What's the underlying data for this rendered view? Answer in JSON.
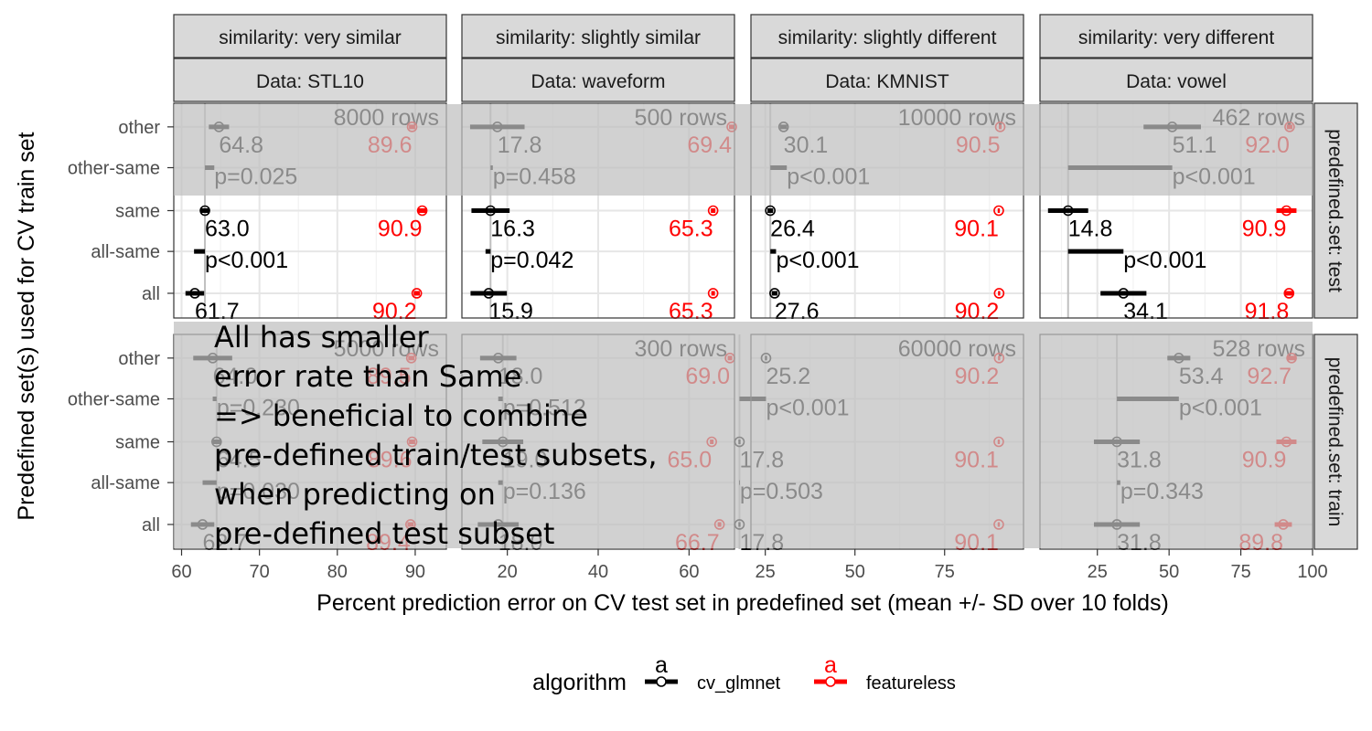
{
  "chart_data": {
    "type": "scatter",
    "columns": [
      {
        "similarity": "similarity: very similar",
        "data": "Data: STL10",
        "xlim": [
          59,
          94
        ],
        "ticks": [
          60,
          70,
          80,
          90
        ]
      },
      {
        "similarity": "similarity: slightly similar",
        "data": "Data: waveform",
        "xlim": [
          10,
          70
        ],
        "ticks": [
          20,
          40,
          60
        ]
      },
      {
        "similarity": "similarity: slightly different",
        "data": "Data: KMNIST",
        "xlim": [
          21,
          97
        ],
        "ticks": [
          25,
          50,
          75
        ]
      },
      {
        "similarity": "similarity: very different",
        "data": "Data: vowel",
        "xlim": [
          5,
          100
        ],
        "ticks": [
          25,
          50,
          75,
          100
        ]
      }
    ],
    "rows": [
      {
        "label": "predefined.set: test"
      },
      {
        "label": "predefined.set: train"
      }
    ],
    "categories": [
      "other",
      "other-same",
      "same",
      "all-same",
      "all"
    ],
    "xlabel": "Percent prediction error on CV test set in predefined set (mean +/- SD over 10 folds)",
    "ylabel": "Predefined set(s) used for CV train set",
    "legend": {
      "title": "algorithm",
      "placement": "bottom",
      "items": [
        {
          "name": "cv_glmnet",
          "color": "#000000",
          "key": "a"
        },
        {
          "name": "featureless",
          "color": "#ff0000",
          "key": "a"
        }
      ]
    },
    "panels": [
      {
        "col": 0,
        "row": 0,
        "rows_text": "8000 rows",
        "points": [
          {
            "cat": "other",
            "algo": "cv_glmnet",
            "mean": 64.8,
            "sd": 1.3,
            "label": "64.8"
          },
          {
            "cat": "other",
            "algo": "featureless",
            "mean": 89.6,
            "sd": 0.4,
            "label": "89.6"
          },
          {
            "cat": "same",
            "algo": "cv_glmnet",
            "mean": 63.0,
            "sd": 0.6,
            "label": "63.0"
          },
          {
            "cat": "same",
            "algo": "featureless",
            "mean": 90.9,
            "sd": 0.6,
            "label": "90.9"
          },
          {
            "cat": "all",
            "algo": "cv_glmnet",
            "mean": 61.7,
            "sd": 1.2,
            "label": "61.7"
          },
          {
            "cat": "all",
            "algo": "featureless",
            "mean": 90.2,
            "sd": 0.4,
            "label": "90.2"
          }
        ],
        "diffs": [
          {
            "cat": "other-same",
            "from": 63.0,
            "to": 64.2,
            "label": "p=0.025"
          },
          {
            "cat": "all-same",
            "from": 61.6,
            "to": 63.0,
            "label": "p<0.001"
          }
        ]
      },
      {
        "col": 1,
        "row": 0,
        "rows_text": "500 rows",
        "points": [
          {
            "cat": "other",
            "algo": "cv_glmnet",
            "mean": 17.8,
            "sd": 6.0,
            "label": "17.8"
          },
          {
            "cat": "other",
            "algo": "featureless",
            "mean": 69.4,
            "sd": 0.6,
            "label": "69.4"
          },
          {
            "cat": "same",
            "algo": "cv_glmnet",
            "mean": 16.3,
            "sd": 4.2,
            "label": "16.3"
          },
          {
            "cat": "same",
            "algo": "featureless",
            "mean": 65.3,
            "sd": 0.5,
            "label": "65.3"
          },
          {
            "cat": "all",
            "algo": "cv_glmnet",
            "mean": 15.9,
            "sd": 4.0,
            "label": "15.9"
          },
          {
            "cat": "all",
            "algo": "featureless",
            "mean": 65.3,
            "sd": 0.4,
            "label": "65.3"
          }
        ],
        "diffs": [
          {
            "cat": "other-same",
            "from": 16.3,
            "to": 16.8,
            "label": "p=0.458"
          },
          {
            "cat": "all-same",
            "from": 15.2,
            "to": 16.3,
            "label": "p=0.042"
          }
        ]
      },
      {
        "col": 2,
        "row": 0,
        "rows_text": "10000 rows",
        "points": [
          {
            "cat": "other",
            "algo": "cv_glmnet",
            "mean": 30.1,
            "sd": 1.0,
            "label": "30.1"
          },
          {
            "cat": "other",
            "algo": "featureless",
            "mean": 90.5,
            "sd": 0.4,
            "label": "90.5"
          },
          {
            "cat": "same",
            "algo": "cv_glmnet",
            "mean": 26.4,
            "sd": 0.8,
            "label": "26.4"
          },
          {
            "cat": "same",
            "algo": "featureless",
            "mean": 90.1,
            "sd": 0.3,
            "label": "90.1"
          },
          {
            "cat": "all",
            "algo": "cv_glmnet",
            "mean": 27.6,
            "sd": 0.8,
            "label": "27.6"
          },
          {
            "cat": "all",
            "algo": "featureless",
            "mean": 90.2,
            "sd": 0.3,
            "label": "90.2"
          }
        ],
        "diffs": [
          {
            "cat": "other-same",
            "from": 26.4,
            "to": 31.0,
            "label": "p<0.001"
          },
          {
            "cat": "all-same",
            "from": 26.4,
            "to": 28.0,
            "label": "p<0.001"
          }
        ]
      },
      {
        "col": 3,
        "row": 0,
        "rows_text": "462 rows",
        "points": [
          {
            "cat": "other",
            "algo": "cv_glmnet",
            "mean": 51.1,
            "sd": 10.0,
            "label": "51.1"
          },
          {
            "cat": "other",
            "algo": "featureless",
            "mean": 92.0,
            "sd": 1.0,
            "label": "92.0"
          },
          {
            "cat": "same",
            "algo": "cv_glmnet",
            "mean": 14.8,
            "sd": 7.0,
            "label": "14.8"
          },
          {
            "cat": "same",
            "algo": "featureless",
            "mean": 90.9,
            "sd": 3.5,
            "label": "90.9"
          },
          {
            "cat": "all",
            "algo": "cv_glmnet",
            "mean": 34.1,
            "sd": 8.0,
            "label": "34.1"
          },
          {
            "cat": "all",
            "algo": "featureless",
            "mean": 91.8,
            "sd": 1.7,
            "label": "91.8"
          }
        ],
        "diffs": [
          {
            "cat": "other-same",
            "from": 14.8,
            "to": 51.1,
            "label": "p<0.001"
          },
          {
            "cat": "all-same",
            "from": 14.8,
            "to": 34.1,
            "label": "p<0.001"
          }
        ]
      },
      {
        "col": 0,
        "row": 1,
        "rows_text": "5000 rows",
        "points": [
          {
            "cat": "other",
            "algo": "cv_glmnet",
            "mean": 64.0,
            "sd": 2.5,
            "label": "64.0"
          },
          {
            "cat": "other",
            "algo": "featureless",
            "mean": 89.5,
            "sd": 0.4,
            "label": "89.5"
          },
          {
            "cat": "same",
            "algo": "cv_glmnet",
            "mean": 64.5,
            "sd": 0.5,
            "label": "64.5"
          },
          {
            "cat": "same",
            "algo": "featureless",
            "mean": 89.6,
            "sd": 0.4,
            "label": "89.6"
          },
          {
            "cat": "all",
            "algo": "cv_glmnet",
            "mean": 62.7,
            "sd": 1.5,
            "label": "62.7"
          },
          {
            "cat": "all",
            "algo": "featureless",
            "mean": 89.4,
            "sd": 0.4,
            "label": "89.4"
          }
        ],
        "diffs": [
          {
            "cat": "other-same",
            "from": 64.0,
            "to": 64.5,
            "label": "p=0.230"
          },
          {
            "cat": "all-same",
            "from": 62.7,
            "to": 64.5,
            "label": "p=0.030"
          }
        ]
      },
      {
        "col": 1,
        "row": 1,
        "rows_text": "300 rows",
        "points": [
          {
            "cat": "other",
            "algo": "cv_glmnet",
            "mean": 18.0,
            "sd": 4.0,
            "label": "18.0"
          },
          {
            "cat": "other",
            "algo": "featureless",
            "mean": 69.0,
            "sd": 0.5,
            "label": "69.0"
          },
          {
            "cat": "same",
            "algo": "cv_glmnet",
            "mean": 19.0,
            "sd": 4.5,
            "label": "19.0"
          },
          {
            "cat": "same",
            "algo": "featureless",
            "mean": 65.0,
            "sd": 0.4,
            "label": "65.0"
          },
          {
            "cat": "all",
            "algo": "cv_glmnet",
            "mean": 18.0,
            "sd": 4.5,
            "label": "18.0"
          },
          {
            "cat": "all",
            "algo": "featureless",
            "mean": 66.7,
            "sd": 0.4,
            "label": "66.7"
          }
        ],
        "diffs": [
          {
            "cat": "other-same",
            "from": 18.0,
            "to": 19.0,
            "label": "p=0.512"
          },
          {
            "cat": "all-same",
            "from": 18.0,
            "to": 19.0,
            "label": "p=0.136"
          }
        ]
      },
      {
        "col": 2,
        "row": 1,
        "rows_text": "60000 rows",
        "points": [
          {
            "cat": "other",
            "algo": "cv_glmnet",
            "mean": 25.2,
            "sd": 0.3,
            "label": "25.2"
          },
          {
            "cat": "other",
            "algo": "featureless",
            "mean": 90.2,
            "sd": 0.3,
            "label": "90.2"
          },
          {
            "cat": "same",
            "algo": "cv_glmnet",
            "mean": 17.8,
            "sd": 0.3,
            "label": "17.8"
          },
          {
            "cat": "same",
            "algo": "featureless",
            "mean": 90.1,
            "sd": 0.3,
            "label": "90.1"
          },
          {
            "cat": "all",
            "algo": "cv_glmnet",
            "mean": 17.8,
            "sd": 0.3,
            "label": "17.8"
          },
          {
            "cat": "all",
            "algo": "featureless",
            "mean": 90.1,
            "sd": 0.3,
            "label": "90.1"
          }
        ],
        "diffs": [
          {
            "cat": "other-same",
            "from": 17.8,
            "to": 25.2,
            "label": "p<0.001"
          },
          {
            "cat": "all-same",
            "from": 17.7,
            "to": 17.9,
            "label": "p=0.503"
          }
        ]
      },
      {
        "col": 3,
        "row": 1,
        "rows_text": "528 rows",
        "points": [
          {
            "cat": "other",
            "algo": "cv_glmnet",
            "mean": 53.4,
            "sd": 4.0,
            "label": "53.4"
          },
          {
            "cat": "other",
            "algo": "featureless",
            "mean": 92.7,
            "sd": 1.5,
            "label": "92.7"
          },
          {
            "cat": "same",
            "algo": "cv_glmnet",
            "mean": 31.8,
            "sd": 8.0,
            "label": "31.8"
          },
          {
            "cat": "same",
            "algo": "featureless",
            "mean": 90.9,
            "sd": 3.5,
            "label": "90.9"
          },
          {
            "cat": "all",
            "algo": "cv_glmnet",
            "mean": 31.8,
            "sd": 8.0,
            "label": "31.8"
          },
          {
            "cat": "all",
            "algo": "featureless",
            "mean": 89.8,
            "sd": 3.0,
            "label": "89.8"
          }
        ],
        "diffs": [
          {
            "cat": "other-same",
            "from": 31.8,
            "to": 53.4,
            "label": "p<0.001"
          },
          {
            "cat": "all-same",
            "from": 31.8,
            "to": 33.0,
            "label": "p=0.343"
          }
        ]
      }
    ],
    "overlays": [
      {
        "target": "row0-upper"
      },
      {
        "target": "row1",
        "lines": [
          "All has smaller",
          "error rate than Same",
          "=> beneficial to combine",
          "pre-defined train/test subsets,",
          "when predicting on",
          "pre-defined test subset"
        ]
      }
    ]
  }
}
